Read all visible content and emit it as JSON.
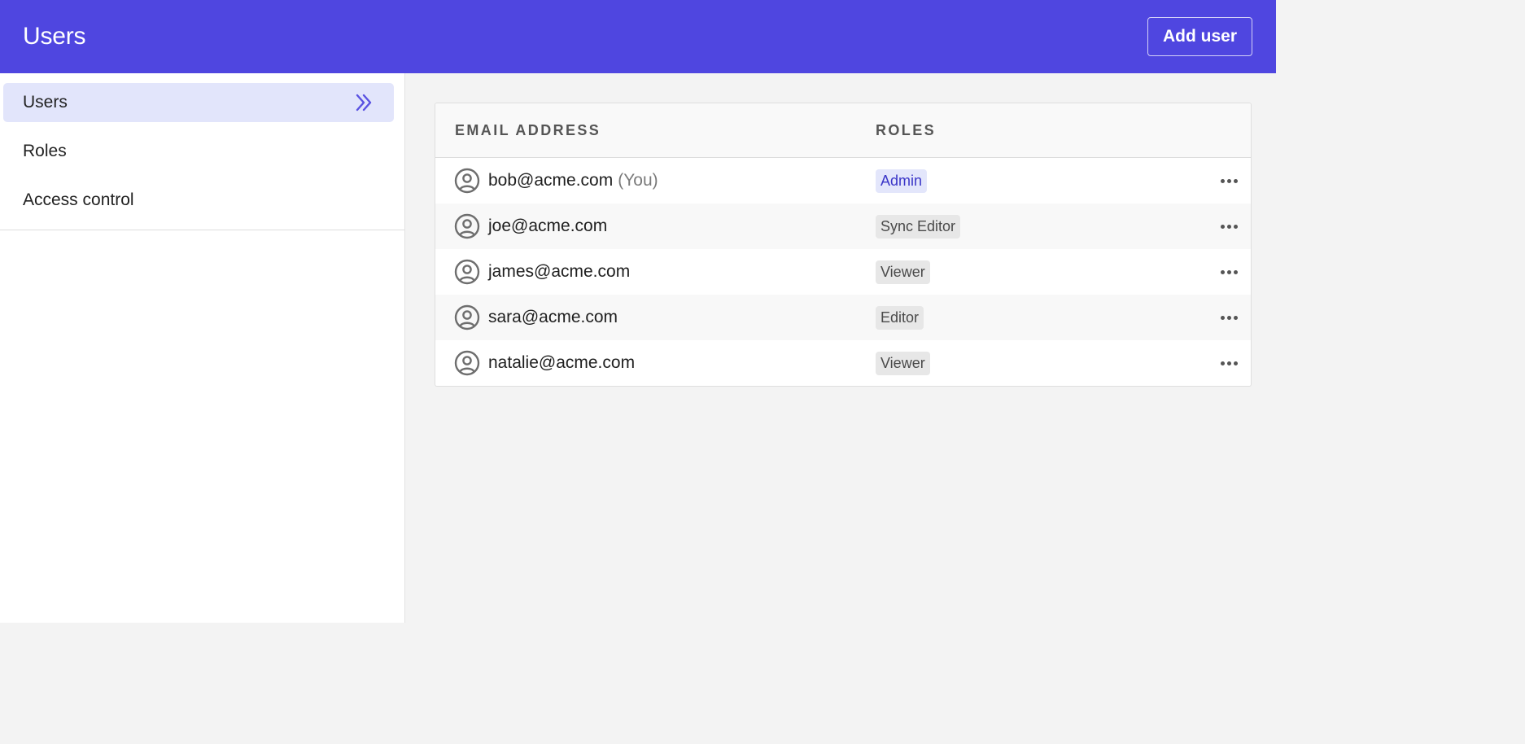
{
  "header": {
    "title": "Users",
    "add_user_label": "Add user"
  },
  "sidebar": {
    "items": [
      {
        "label": "Users",
        "active": true
      },
      {
        "label": "Roles",
        "active": false
      },
      {
        "label": "Access control",
        "active": false
      }
    ]
  },
  "table": {
    "columns": {
      "email": "EMAIL ADDRESS",
      "roles": "ROLES"
    },
    "rows": [
      {
        "email": "bob@acme.com",
        "suffix": "(You)",
        "role": "Admin"
      },
      {
        "email": "joe@acme.com",
        "suffix": "",
        "role": "Sync Editor"
      },
      {
        "email": "james@acme.com",
        "suffix": "",
        "role": "Viewer"
      },
      {
        "email": "sara@acme.com",
        "suffix": "",
        "role": "Editor"
      },
      {
        "email": "natalie@acme.com",
        "suffix": "",
        "role": "Viewer"
      }
    ]
  },
  "colors": {
    "header_bg": "#4f46e0",
    "active_nav_bg": "#e2e5fb",
    "admin_badge_text": "#3b36c8"
  },
  "icons": {
    "nav_active": "chevrons-right-icon",
    "avatar": "user-circle-icon",
    "row_menu": "more-horizontal-icon"
  }
}
